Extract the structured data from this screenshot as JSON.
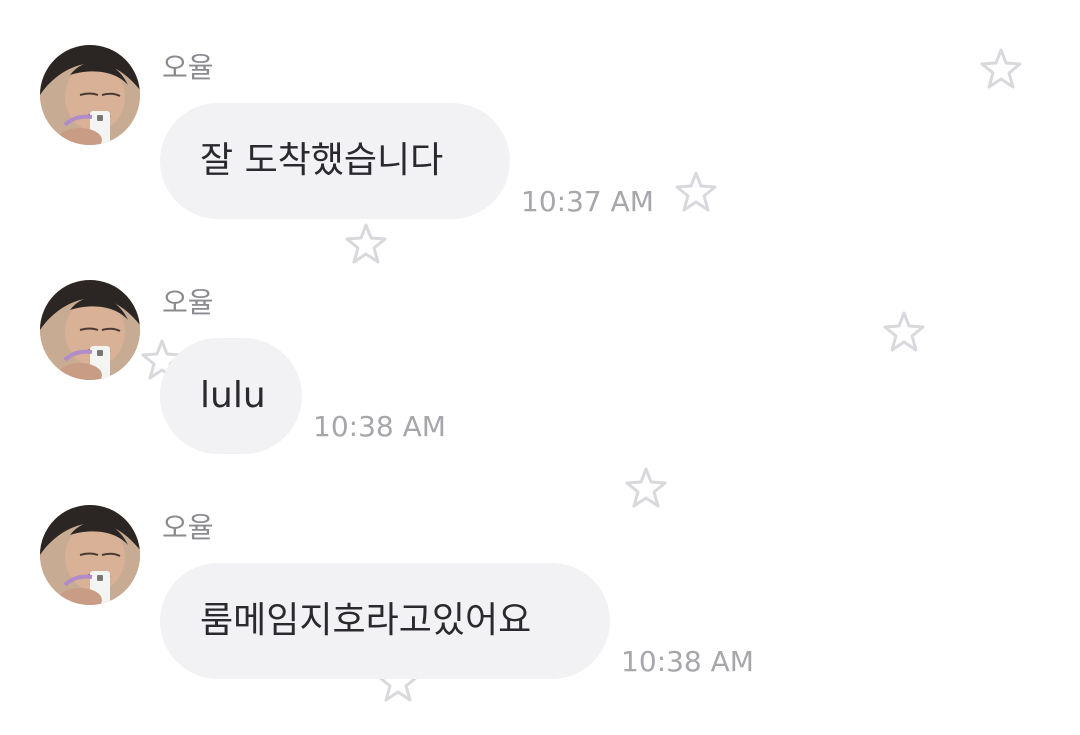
{
  "theme": {
    "background": "#ffffff",
    "bubble_color": "#f2f2f5",
    "text_color": "#2a2a2e",
    "meta_color": "#a6a6ab",
    "star_color": "#d9d9dd"
  },
  "decorations": {
    "icon": "star-outline-icon"
  },
  "messages": [
    {
      "sender": "오율",
      "avatar_icon": "profile-photo",
      "text": "잘 도착했습니다",
      "time": "10:37 AM"
    },
    {
      "sender": "오율",
      "avatar_icon": "profile-photo",
      "text": "lulu",
      "time": "10:38 AM"
    },
    {
      "sender": "오율",
      "avatar_icon": "profile-photo",
      "text": "룸메임지호라고있어요",
      "time": "10:38 AM"
    }
  ]
}
